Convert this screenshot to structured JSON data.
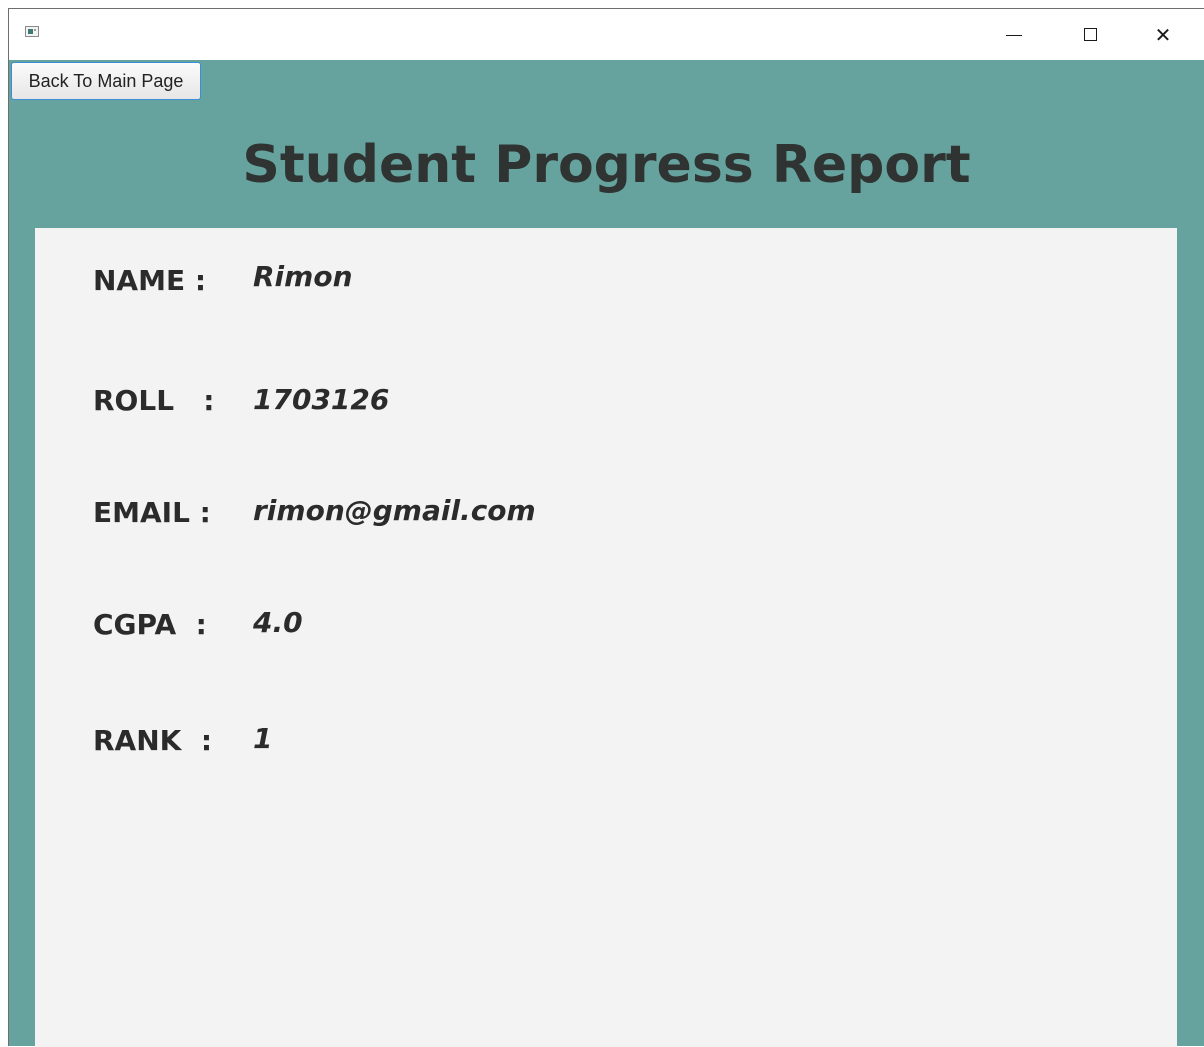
{
  "window": {
    "icon": "app-window-icon",
    "controls": {
      "minimize_icon": "minimize-icon",
      "maximize_icon": "maximize-icon",
      "close_glyph": "✕"
    }
  },
  "toolbar": {
    "back_label": "Back To Main Page"
  },
  "page": {
    "title": "Student Progress Report"
  },
  "student": {
    "name_label": "NAME :",
    "name_value": "Rimon",
    "roll_label": "ROLL   :",
    "roll_value": "1703126",
    "email_label": "EMAIL :",
    "email_value": "rimon@gmail.com",
    "cgpa_label": "CGPA  :",
    "cgpa_value": "4.0",
    "rank_label": "RANK  :",
    "rank_value": "1"
  },
  "colors": {
    "background": "#66a39e",
    "card": "#f3f3f3",
    "text": "#2f3331",
    "button_border": "#3b8fd4"
  }
}
